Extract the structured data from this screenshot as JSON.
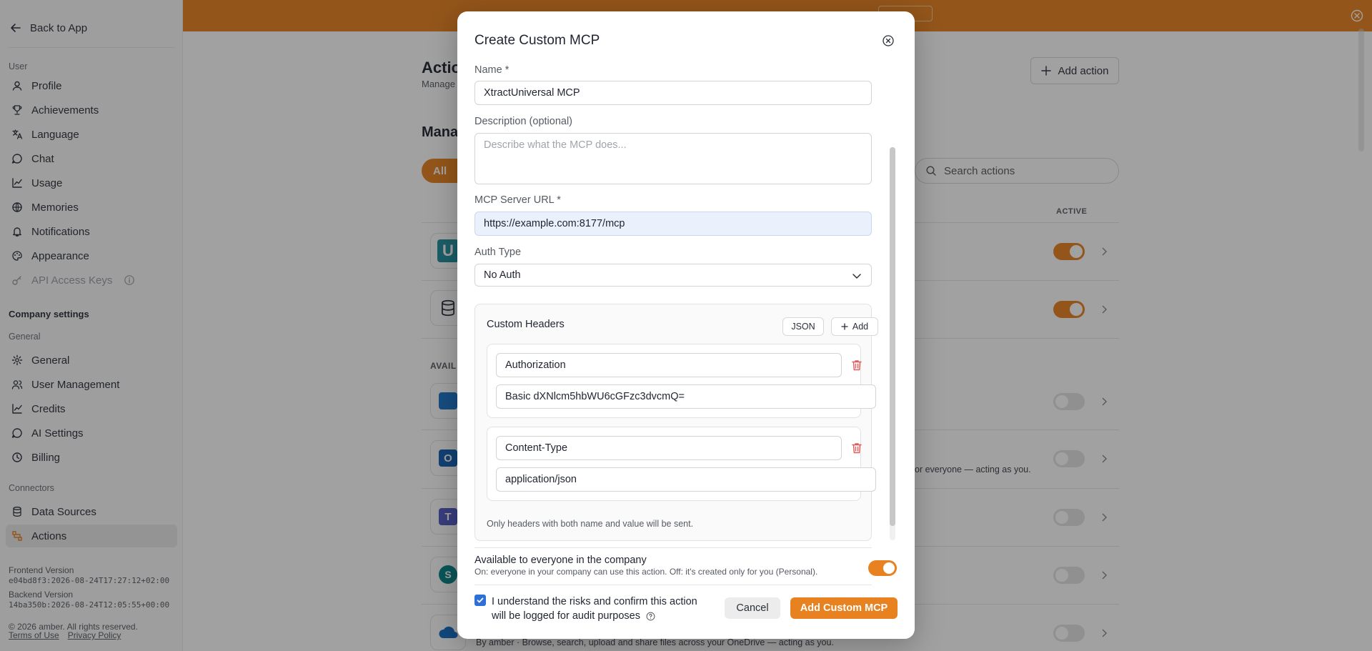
{
  "sidebar": {
    "back_label": "Back to App",
    "user_group": "User",
    "user_items": [
      {
        "label": "Profile"
      },
      {
        "label": "Achievements"
      },
      {
        "label": "Language"
      },
      {
        "label": "Chat"
      },
      {
        "label": "Usage"
      },
      {
        "label": "Memories"
      },
      {
        "label": "Notifications"
      },
      {
        "label": "Appearance"
      },
      {
        "label": "API Access Keys"
      }
    ],
    "company_group": "Company settings",
    "general_group": "General",
    "general_items": [
      {
        "label": "General"
      },
      {
        "label": "User Management"
      },
      {
        "label": "Credits"
      },
      {
        "label": "AI Settings"
      },
      {
        "label": "Billing"
      }
    ],
    "connectors_group": "Connectors",
    "connector_items": [
      {
        "label": "Data Sources"
      },
      {
        "label": "Actions"
      }
    ],
    "frontend_label": "Frontend Version",
    "frontend_value": "e04bd8f3:2026-08-24T17:27:12+02:00",
    "backend_label": "Backend Version",
    "backend_value": "14ba350b:2026-08-24T12:05:55+00:00",
    "copyright": "© 2026 amber. All rights reserved.",
    "terms": "Terms of Use",
    "privacy": "Privacy Policy"
  },
  "page": {
    "title": "Actio",
    "subtitle": "Manage",
    "add_action": "Add action",
    "section_title": "Mana",
    "filter_all": "All",
    "search_placeholder": "Search actions",
    "col_active": "ACTIVE",
    "available_label": "AVAIL",
    "row_desc_1": "or everyone — acting as you.",
    "row_desc_2": "By amber · Browse, search, upload and share files across your OneDrive — acting as you."
  },
  "modal": {
    "title": "Create Custom MCP",
    "name_label": "Name *",
    "name_value": "XtractUniversal MCP",
    "description_label": "Description (optional)",
    "description_placeholder": "Describe what the MCP does...",
    "url_label": "MCP Server URL *",
    "url_value": "https://example.com:8177/mcp",
    "auth_label": "Auth Type",
    "auth_value": "No Auth",
    "headers_title": "Custom Headers",
    "json_button": "JSON",
    "add_button": "Add",
    "headers": [
      {
        "name": "Authorization",
        "value": "Basic dXNlcm5hbWU6cGFzc3dvcmQ="
      },
      {
        "name": "Content-Type",
        "value": "application/json"
      }
    ],
    "headers_hint": "Only headers with both name and value will be sent.",
    "available_title": "Available to everyone in the company",
    "available_sub": "On: everyone in your company can use this action. Off: it's created only for you (Personal).",
    "confirm_text": "I understand the risks and confirm this action will be logged for audit purposes",
    "cancel": "Cancel",
    "submit": "Add Custom MCP"
  },
  "colors": {
    "accent": "#e8811f",
    "checkbox": "#2e6fd8",
    "delete": "#e05a5a"
  }
}
